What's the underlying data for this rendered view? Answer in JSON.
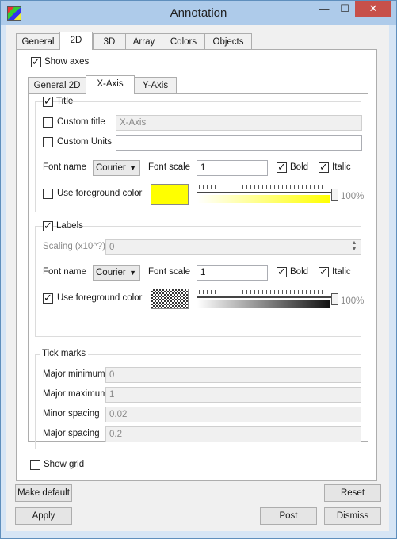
{
  "window": {
    "title": "Annotation"
  },
  "main_tabs": [
    "General",
    "2D",
    "3D",
    "Array",
    "Colors",
    "Objects"
  ],
  "show_axes": {
    "label": "Show axes",
    "checked": true
  },
  "axis_tabs": [
    "General 2D",
    "X-Axis",
    "Y-Axis"
  ],
  "title_section": {
    "label": "Title",
    "checked": true,
    "custom_title": {
      "label": "Custom title",
      "checked": false,
      "value": "X-Axis"
    },
    "custom_units": {
      "label": "Custom Units",
      "checked": false,
      "value": ""
    },
    "font_name_label": "Font name",
    "font_name": "Courier",
    "font_scale_label": "Font scale",
    "font_scale": "1",
    "bold": {
      "label": "Bold",
      "checked": true
    },
    "italic": {
      "label": "Italic",
      "checked": true
    },
    "use_fg": {
      "label": "Use foreground color",
      "checked": false
    },
    "color": "#ffff00",
    "opacity_text": "100%",
    "opacity_level": 1.0
  },
  "labels_section": {
    "label": "Labels",
    "checked": true,
    "scaling_label": "Scaling (x10^?)",
    "scaling_value": "0",
    "font_name_label": "Font name",
    "font_name": "Courier",
    "font_scale_label": "Font scale",
    "font_scale": "1",
    "bold": {
      "label": "Bold",
      "checked": true
    },
    "italic": {
      "label": "Italic",
      "checked": true
    },
    "use_fg": {
      "label": "Use foreground color",
      "checked": true
    },
    "opacity_text": "100%",
    "opacity_level": 1.0
  },
  "tick_marks": {
    "title": "Tick marks",
    "rows": [
      {
        "label": "Major minimum",
        "value": "0"
      },
      {
        "label": "Major maximum",
        "value": "1"
      },
      {
        "label": "Minor spacing",
        "value": "0.02"
      },
      {
        "label": "Major spacing",
        "value": "0.2"
      }
    ]
  },
  "show_grid": {
    "label": "Show grid",
    "checked": false
  },
  "buttons": {
    "make_default": "Make default",
    "reset": "Reset",
    "apply": "Apply",
    "post": "Post",
    "dismiss": "Dismiss"
  }
}
